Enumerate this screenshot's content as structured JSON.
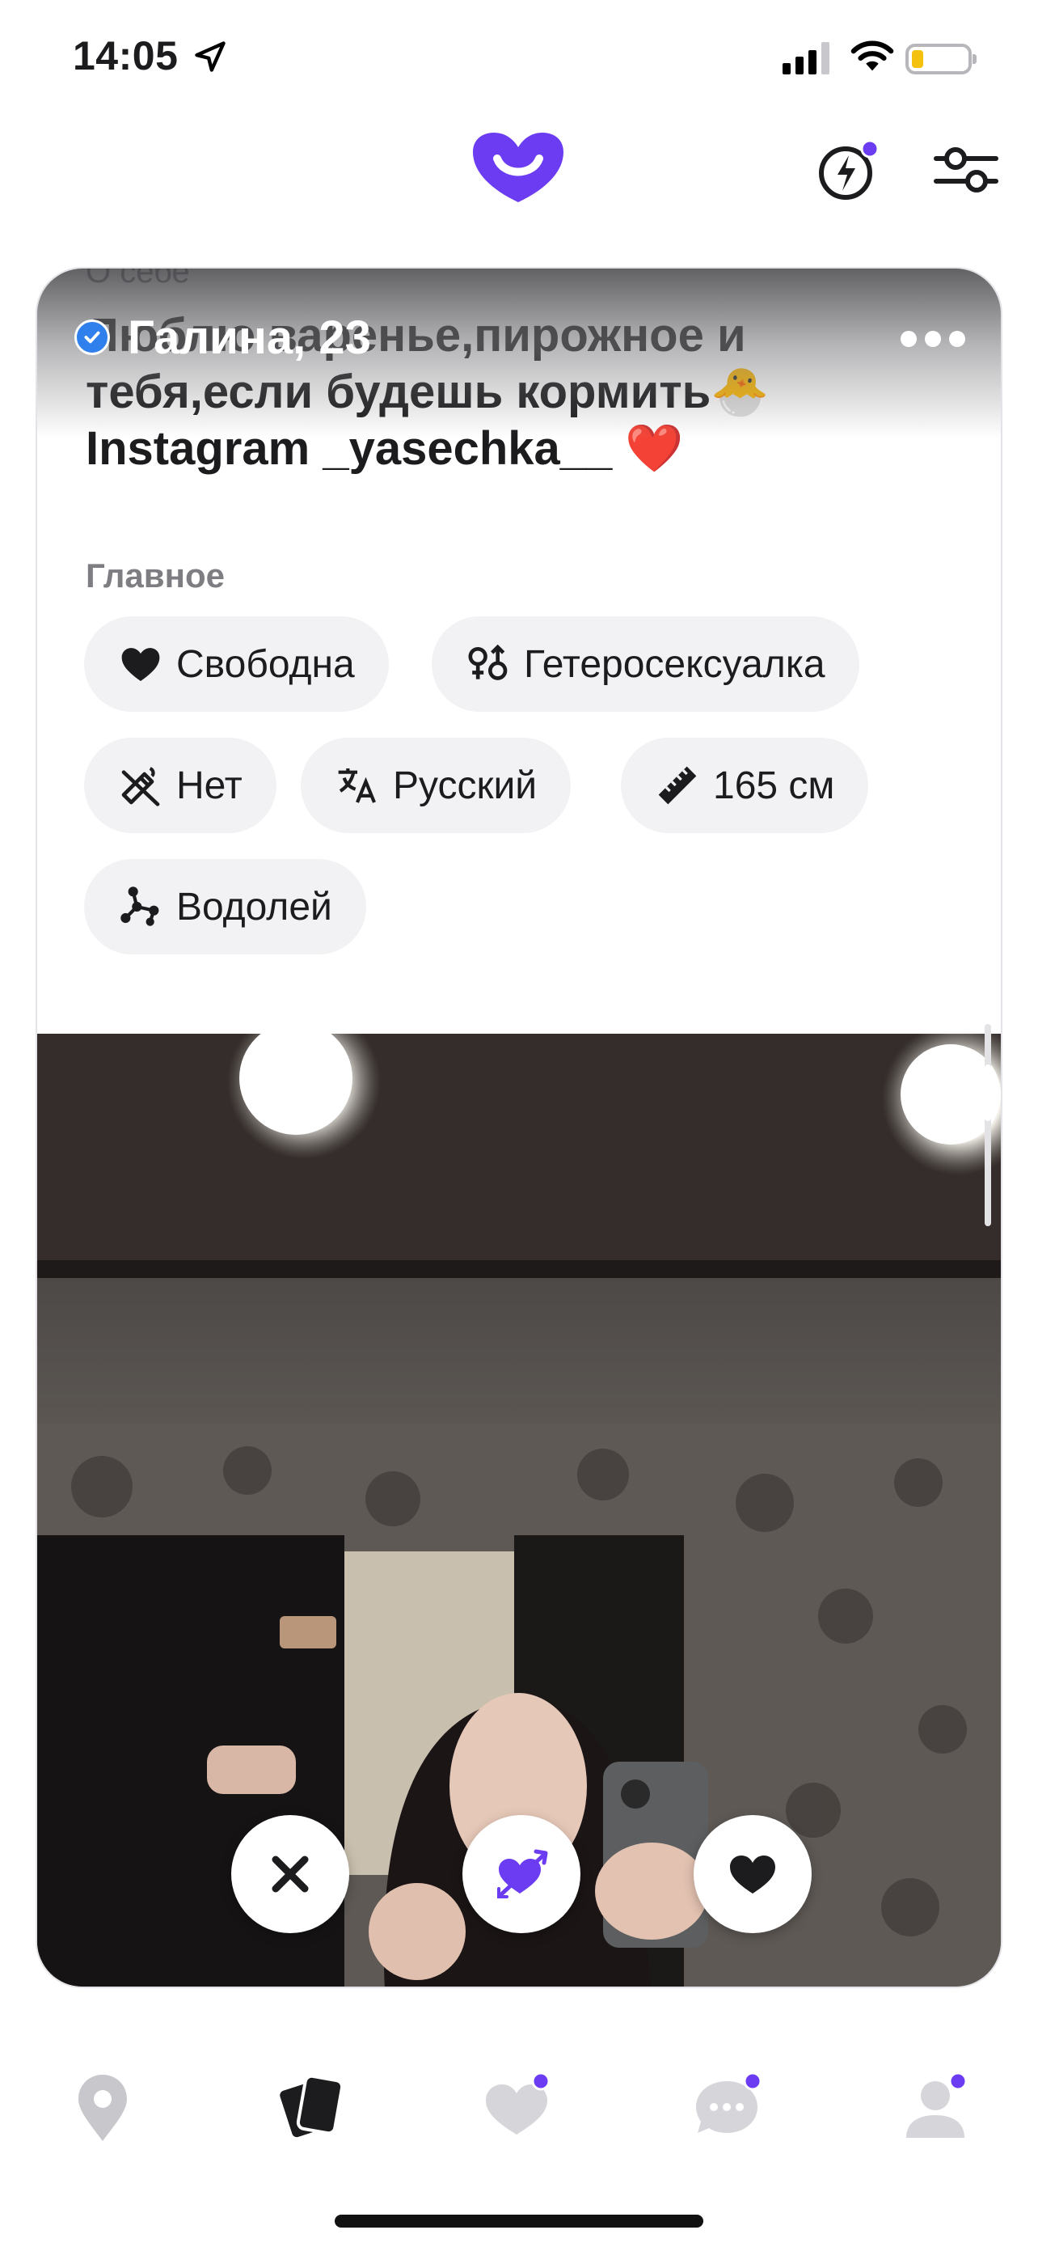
{
  "status_bar": {
    "time": "14:05"
  },
  "colors": {
    "brand": "#6b3cf2",
    "verified": "#2f80ed",
    "battery": "#f4c10f",
    "tag_bg": "#f2f2f4"
  },
  "header": {
    "logo_icon": "smile-heart-logo",
    "spark_icon": "lightning-icon",
    "filter_icon": "sliders-icon"
  },
  "profile": {
    "name_age": "Галина, 23",
    "about_label": "О себе",
    "about_text": "Люблю варенье,пирожное и тебя,если будешь кормить🐣 Instagram _yasechka__ ❤️",
    "main_label": "Главное",
    "tags": [
      {
        "icon": "heart-icon",
        "label": "Свободна"
      },
      {
        "icon": "gender-icon",
        "label": "Гетеросексуалка"
      },
      {
        "icon": "no-smoking-icon",
        "label": "Нет"
      },
      {
        "icon": "translate-icon",
        "label": "Русский"
      },
      {
        "icon": "ruler-icon",
        "label": "165 см"
      },
      {
        "icon": "constellation-icon",
        "label": "Водолей"
      }
    ]
  },
  "actions": [
    "dislike",
    "super-like",
    "like"
  ],
  "tabbar": [
    "map",
    "cards",
    "likes",
    "chats",
    "profile"
  ]
}
